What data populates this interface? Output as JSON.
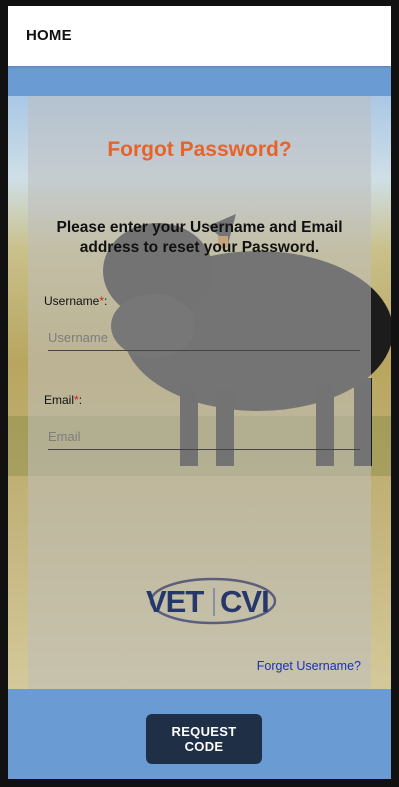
{
  "topbar": {
    "title": "HOME"
  },
  "form": {
    "heading": "Forgot Password?",
    "instruction": "Please enter your Username and Email address to reset your Password.",
    "username": {
      "label": "Username",
      "required_mark": "*",
      "suffix": ":",
      "placeholder": "Username",
      "value": ""
    },
    "email": {
      "label": "Email",
      "required_mark": "*",
      "suffix": ":",
      "placeholder": "Email",
      "value": ""
    },
    "forget_username_link": "Forget Username?"
  },
  "logo": {
    "text_left": "VET",
    "text_right": "CVI"
  },
  "footer": {
    "request_button_label": "REQUEST CODE"
  },
  "colors": {
    "accent_orange": "#e8632a",
    "band_blue": "#6a9bd2",
    "button_navy": "#1f2f45",
    "link_blue": "#1a2fbf",
    "required_red": "#d42222",
    "logo_navy": "#26386b"
  },
  "icons": [
    "background-photo-cow",
    "vet-cvi-logo"
  ]
}
